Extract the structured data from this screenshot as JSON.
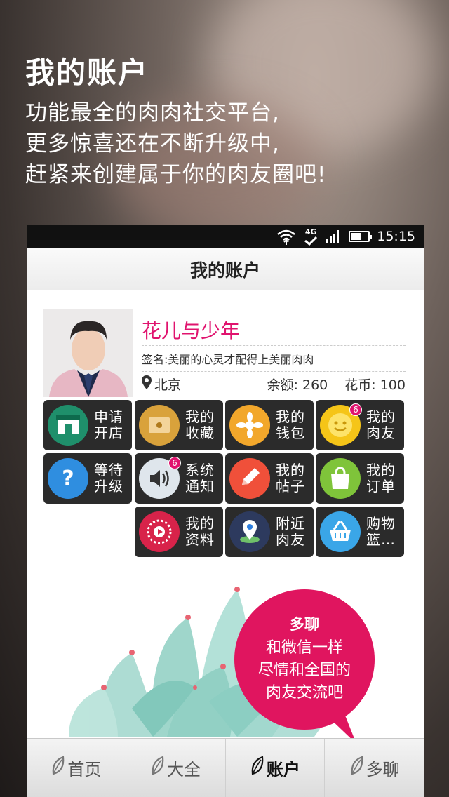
{
  "promo": {
    "title": "我的账户",
    "lines": [
      "功能最全的肉肉社交平台,",
      "更多惊喜还在不断升级中,",
      "赶紧来创建属于你的肉友圈吧!"
    ]
  },
  "status_bar": {
    "time": "15:15",
    "network": "4G",
    "battery_level": 0.6
  },
  "app": {
    "title": "我的账户"
  },
  "profile": {
    "name": "花儿与少年",
    "signature": "签名:美丽的心灵才配得上美丽肉肉",
    "location": "北京",
    "balance": "余额: 260",
    "coins": "花币: 100"
  },
  "menu": [
    {
      "label": "申请开店",
      "icon": "shop-icon",
      "color": "#1f8f6b"
    },
    {
      "label": "我的收藏",
      "icon": "folder-icon",
      "color": "#d9a23b"
    },
    {
      "label": "我的钱包",
      "icon": "flower-wallet-icon",
      "color": "#f2a72b"
    },
    {
      "label": "我的肉友",
      "icon": "smile-friends-icon",
      "color": "#f5c518",
      "badge": "6"
    },
    {
      "label": "等待升级",
      "icon": "question-icon",
      "color": "#2f8ee0"
    },
    {
      "label": "系统通知",
      "icon": "speaker-icon",
      "color": "#dfe6ec",
      "badge": "6"
    },
    {
      "label": "我的帖子",
      "icon": "pencil-icon",
      "color": "#f0503a"
    },
    {
      "label": "我的订单",
      "icon": "shopping-bag-icon",
      "color": "#7fc43a"
    },
    {
      "label": "我的资料",
      "icon": "profile-dial-icon",
      "color": "#d8234a"
    },
    {
      "label": "附近肉友",
      "icon": "location-pin-icon",
      "color": "#2d3a5e"
    },
    {
      "label": "购物篮…",
      "icon": "basket-icon",
      "color": "#3aa6e8"
    }
  ],
  "chat_bubble": {
    "title": "多聊",
    "lines": [
      "和微信一样",
      "尽情和全国的",
      "肉友交流吧"
    ]
  },
  "tabs": [
    {
      "label": "首页",
      "active": false
    },
    {
      "label": "大全",
      "active": false
    },
    {
      "label": "账户",
      "active": true
    },
    {
      "label": "多聊",
      "active": false
    }
  ]
}
